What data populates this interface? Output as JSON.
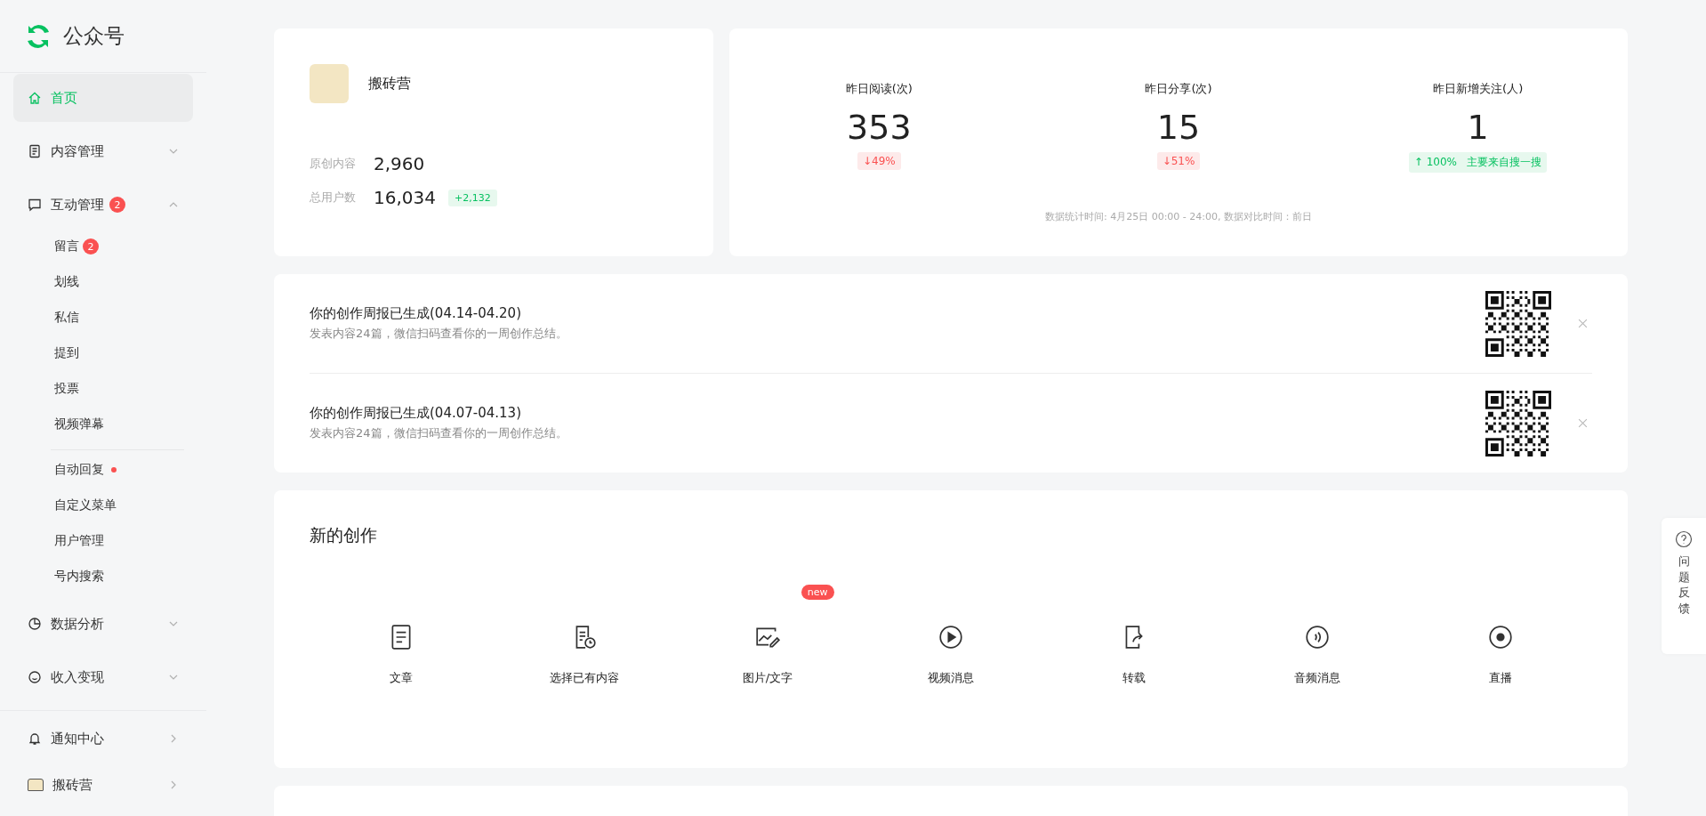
{
  "sidebar": {
    "logo": "公众号",
    "nav": [
      {
        "label": "首页",
        "selected": true
      },
      {
        "label": "内容管理",
        "selected": false,
        "expanded": false
      },
      {
        "label": "互动管理",
        "selected": false,
        "expanded": true,
        "badge": "2",
        "children": [
          {
            "items": [
              {
                "label": "留言",
                "badge": "2"
              },
              {
                "label": "划线"
              },
              {
                "label": "私信"
              },
              {
                "label": "提到"
              },
              {
                "label": "投票"
              },
              {
                "label": "视频弹幕"
              }
            ]
          },
          {
            "items": [
              {
                "label": "自动回复",
                "dot": true
              },
              {
                "label": "自定义菜单"
              },
              {
                "label": "用户管理"
              },
              {
                "label": "号内搜索"
              }
            ]
          }
        ]
      },
      {
        "label": "数据分析",
        "selected": false,
        "expanded": false
      },
      {
        "label": "收入变现",
        "selected": false,
        "expanded": false
      }
    ],
    "bottom": [
      {
        "label": "通知中心",
        "kind": "bell"
      },
      {
        "label": "搬砖营",
        "kind": "avatar"
      }
    ]
  },
  "profile": {
    "name": "搬砖营",
    "stats": [
      {
        "label": "原创内容",
        "value": "2,960"
      },
      {
        "label": "总用户数",
        "value": "16,034",
        "delta": "+2,132"
      }
    ]
  },
  "yesterday": {
    "metrics": [
      {
        "label": "昨日阅读(次)",
        "value": "353",
        "change": "↓49%",
        "rising": false
      },
      {
        "label": "昨日分享(次)",
        "value": "15",
        "change": "↓51%",
        "rising": false
      },
      {
        "label": "昨日新增关注(人)",
        "value": "1",
        "change": "↑ 100%",
        "rising": true,
        "note": "主要来自搜一搜"
      }
    ],
    "footnote": "数据统计时间: 4月25日 00:00 - 24:00, 数据对比时间：前日"
  },
  "reports": [
    {
      "title": "你的创作周报已生成(04.14-04.20)",
      "subtitle": "发表内容24篇，微信扫码查看你的一周创作总结。"
    },
    {
      "title": "你的创作周报已生成(04.07-04.13)",
      "subtitle": "发表内容24篇，微信扫码查看你的一周创作总结。"
    }
  ],
  "creation": {
    "title": "新的创作",
    "items": [
      {
        "label": "文章"
      },
      {
        "label": "选择已有内容"
      },
      {
        "label": "图片/文字",
        "badge": "new"
      },
      {
        "label": "视频消息"
      },
      {
        "label": "转载"
      },
      {
        "label": "音频消息"
      },
      {
        "label": "直播"
      }
    ]
  },
  "feedback": {
    "label": "问题反馈"
  }
}
